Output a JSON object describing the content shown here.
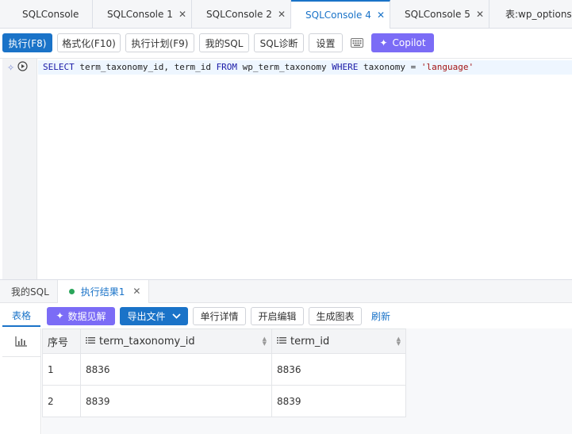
{
  "tabs": [
    {
      "label": "SQLConsole",
      "closable": false,
      "active": false
    },
    {
      "label": "SQLConsole 1",
      "closable": true,
      "active": false
    },
    {
      "label": "SQLConsole 2",
      "closable": true,
      "active": false
    },
    {
      "label": "SQLConsole 4",
      "closable": true,
      "active": true
    },
    {
      "label": "SQLConsole 5",
      "closable": true,
      "active": false
    },
    {
      "label": "表:wp_options",
      "closable": false,
      "active": false
    }
  ],
  "toolbar": {
    "execute": "执行(F8)",
    "format": "格式化(F10)",
    "plan": "执行计划(F9)",
    "my_sql": "我的SQL",
    "diagnose": "SQL诊断",
    "settings": "设置",
    "copilot": "Copilot"
  },
  "editor": {
    "line": {
      "k1": "SELECT",
      "t1": " term_taxonomy_id, term_id ",
      "k2": "FROM",
      "t2": " wp_term_taxonomy ",
      "k3": "WHERE",
      "t3": " taxonomy = ",
      "s1": "'language'"
    }
  },
  "result_tabs": {
    "my_sql": "我的SQL",
    "result1": "执行结果1"
  },
  "result_toolbar": {
    "table": "表格",
    "insight": "数据见解",
    "export": "导出文件",
    "row_detail": "单行详情",
    "edit": "开启编辑",
    "chart": "生成图表",
    "refresh": "刷新"
  },
  "grid": {
    "headers": [
      "序号",
      "term_taxonomy_id",
      "term_id"
    ],
    "rows": [
      [
        "1",
        "8836",
        "8836"
      ],
      [
        "2",
        "8839",
        "8839"
      ]
    ]
  },
  "colors": {
    "primary": "#1a73c8",
    "copilot": "#7b6cf6",
    "status_ok": "#2aa55a"
  }
}
